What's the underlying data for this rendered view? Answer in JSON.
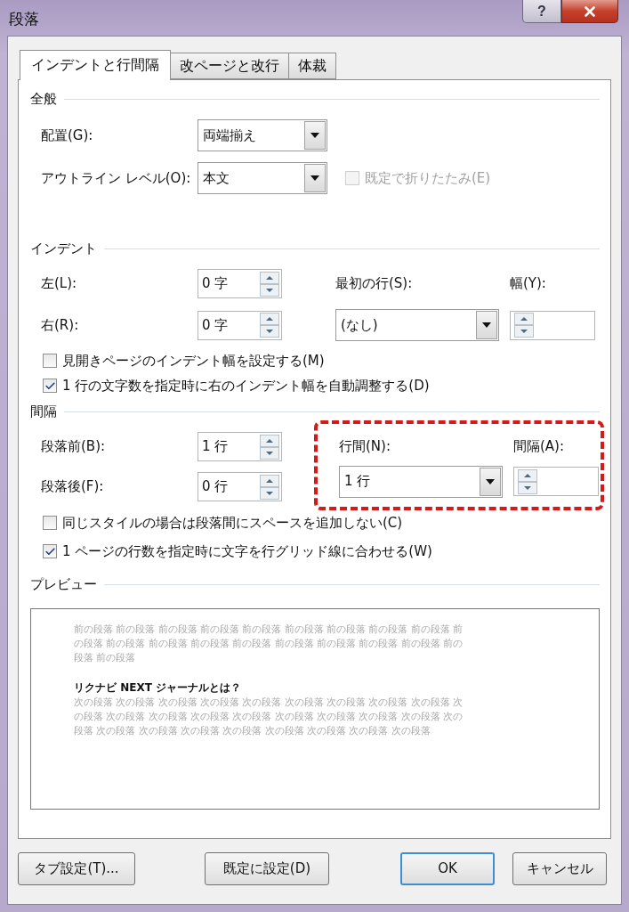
{
  "window": {
    "title": "段落",
    "help_label": "?"
  },
  "tabs": [
    {
      "label": "インデントと行間隔",
      "selected": true
    },
    {
      "label": "改ページと改行",
      "selected": false
    },
    {
      "label": "体裁",
      "selected": false
    }
  ],
  "general": {
    "heading": "全般",
    "alignment": {
      "label": "配置(G):",
      "value": "両端揃え"
    },
    "outline_level": {
      "label": "アウトライン レベル(O):",
      "value": "本文"
    },
    "collapse": {
      "label": "既定で折りたたみ(E)",
      "checked": false,
      "disabled": true
    }
  },
  "indent": {
    "heading": "インデント",
    "left": {
      "label": "左(L):",
      "value": "0 字"
    },
    "right": {
      "label": "右(R):",
      "value": "0 字"
    },
    "first_line": {
      "label": "最初の行(S):",
      "value": "(なし)"
    },
    "width": {
      "label": "幅(Y):"
    },
    "options": [
      {
        "label": "見開きページのインデント幅を設定する(M)",
        "checked": false
      },
      {
        "label": "1 行の文字数を指定時に右のインデント幅を自動調整する(D)",
        "checked": true
      }
    ]
  },
  "spacing": {
    "heading": "間隔",
    "before": {
      "label": "段落前(B):",
      "value": "1 行"
    },
    "after": {
      "label": "段落後(F):",
      "value": "0 行"
    },
    "line_spacing": {
      "label": "行間(N):",
      "value": "1 行"
    },
    "at": {
      "label": "間隔(A):"
    },
    "highlighted": true,
    "options": [
      {
        "label": "同じスタイルの場合は段落間にスペースを追加しない(C)",
        "checked": false
      },
      {
        "label": "1 ページの行数を指定時に文字を行グリッド線に合わせる(W)",
        "checked": true
      }
    ]
  },
  "preview": {
    "heading": "プレビュー",
    "previous": [
      "前の段落 前の段落 前の段落 前の段落 前の段落 前の段落 前の段落 前の段落 前の段落 前",
      "の段落 前の段落 前の段落 前の段落 前の段落 前の段落 前の段落 前の段落 前の段落 前の",
      "段落 前の段落"
    ],
    "sample": "リクナビ NEXT ジャーナルとは？",
    "next": [
      "次の段落 次の段落 次の段落 次の段落 次の段落 次の段落 次の段落 次の段落 次の段落 次",
      "の段落 次の段落 次の段落 次の段落 次の段落 次の段落 次の段落 次の段落 次の段落 次の",
      "段落 次の段落 次の段落 次の段落 次の段落 次の段落 次の段落 次の段落 次の段落"
    ]
  },
  "buttons": [
    {
      "label": "タブ設定(T)...",
      "default": false
    },
    {
      "label": "既定に設定(D)",
      "default": false
    },
    {
      "label": "OK",
      "default": true
    },
    {
      "label": "キャンセル",
      "default": false
    }
  ]
}
